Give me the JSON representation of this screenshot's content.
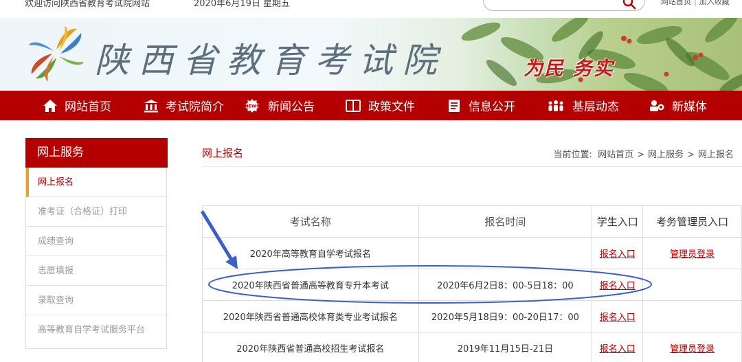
{
  "topbar": {
    "welcome": "欢迎访问陕西省教育考试院网站",
    "date": "2020年6月19日  星期五",
    "search_placeholder": "",
    "link_home": "网站首页",
    "link_sep": "|",
    "link_favorite": "加入收藏"
  },
  "banner": {
    "site_name": "陕西省教育考试院",
    "slogan": "为民  务实"
  },
  "nav": {
    "items": [
      {
        "label": "网站首页",
        "icon": "home-icon"
      },
      {
        "label": "考试院简介",
        "icon": "institution-icon"
      },
      {
        "label": "新闻公告",
        "icon": "news-icon"
      },
      {
        "label": "政策文件",
        "icon": "book-icon"
      },
      {
        "label": "信息公开",
        "icon": "document-icon"
      },
      {
        "label": "基层动态",
        "icon": "people-icon"
      },
      {
        "label": "新媒体",
        "icon": "media-icon"
      }
    ]
  },
  "sidebar": {
    "title": "网上服务",
    "items": [
      {
        "label": "网上报名"
      },
      {
        "label": "准考证（合格证）打印"
      },
      {
        "label": "成绩查询"
      },
      {
        "label": "志愿填报"
      },
      {
        "label": "录取查询"
      },
      {
        "label": "高等教育自学考试服务平台"
      }
    ]
  },
  "content": {
    "title": "网上报名",
    "breadcrumb": {
      "prefix": "当前位置:",
      "items": [
        "网站首页",
        "网上服务",
        "网上报名"
      ],
      "arrow": ">"
    }
  },
  "table": {
    "headers": [
      "考试名称",
      "报名时间",
      "学生入口",
      "考务管理员入口"
    ],
    "rows": [
      {
        "name": "2020年高等教育自学考试报名",
        "time": "",
        "student": "报名入口",
        "admin": "管理员登录"
      },
      {
        "name": "2020年陕西省普通高等教育专升本考试",
        "time": "2020年6月2日8：00-5日18：00",
        "student": "报名入口",
        "admin": ""
      },
      {
        "name": "2020年陕西省普通高校体育类专业考试报名",
        "time": "2020年5月18日9：00-20日17：00",
        "student": "报名入口",
        "admin": ""
      },
      {
        "name": "2020年陕西省普通高校招生考试报名",
        "time": "2019年11月15日-21日",
        "student": "报名入口",
        "admin": "管理员登录"
      }
    ]
  },
  "colors": {
    "brand_red": "#b40000",
    "annotation_blue": "#3a5fc8",
    "active_marker": "#f0a020"
  }
}
